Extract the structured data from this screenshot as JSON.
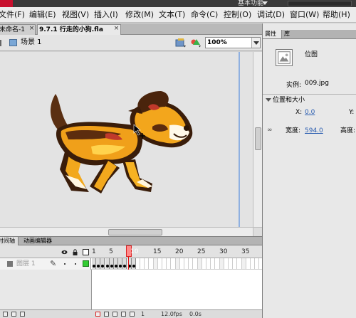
{
  "titlebar": {
    "workspace_label": "基本功能"
  },
  "menubar": {
    "items": [
      {
        "label": "文件(F)"
      },
      {
        "label": "编辑(E)"
      },
      {
        "label": "视图(V)"
      },
      {
        "label": "插入(I)"
      },
      {
        "label": "修改(M)"
      },
      {
        "label": "文本(T)"
      },
      {
        "label": "命令(C)"
      },
      {
        "label": "控制(O)"
      },
      {
        "label": "调试(D)"
      },
      {
        "label": "窗口(W)"
      },
      {
        "label": "帮助(H)"
      }
    ]
  },
  "doc_tabs": [
    {
      "label": "未命名-1",
      "close": "×"
    },
    {
      "label": "9.7.1 行走的小狗.fla",
      "close": "×"
    }
  ],
  "editbar": {
    "scene_label": "场景 1",
    "zoom": "100%"
  },
  "timeline": {
    "tabs": [
      "时间轴",
      "动画编辑器"
    ],
    "frame_numbers": [
      "1",
      "5",
      "10",
      "15",
      "20",
      "25",
      "30",
      "35"
    ],
    "current_frame_highlight": "10",
    "layer": {
      "name": "图层 1",
      "color": "#33cc33"
    },
    "keyframe_count": 10,
    "status": {
      "current_frame": "1",
      "fps": "12.0fps",
      "elapsed": "0.0s"
    }
  },
  "right_panel": {
    "tabs": [
      "属性",
      "库"
    ],
    "symbol_type": "位图",
    "instance_label": "实例:",
    "instance_value": "009.jpg",
    "position_section": "位置和大小",
    "x_label": "X:",
    "x_value": "0.0",
    "y_label": "Y:",
    "width_label": "宽度:",
    "width_value": "594.0",
    "height_label": "高度:"
  },
  "colors": {
    "accent_red": "#e01010",
    "stage_edge": "#8fb0e0",
    "link_blue": "#2a5db0"
  }
}
